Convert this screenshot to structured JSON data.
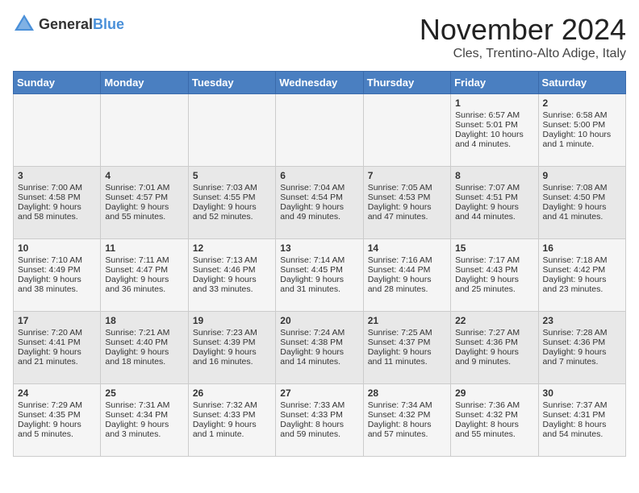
{
  "header": {
    "logo_general": "General",
    "logo_blue": "Blue",
    "month_title": "November 2024",
    "location": "Cles, Trentino-Alto Adige, Italy"
  },
  "days_of_week": [
    "Sunday",
    "Monday",
    "Tuesday",
    "Wednesday",
    "Thursday",
    "Friday",
    "Saturday"
  ],
  "weeks": [
    [
      {
        "day": "",
        "info": ""
      },
      {
        "day": "",
        "info": ""
      },
      {
        "day": "",
        "info": ""
      },
      {
        "day": "",
        "info": ""
      },
      {
        "day": "",
        "info": ""
      },
      {
        "day": "1",
        "info": "Sunrise: 6:57 AM\nSunset: 5:01 PM\nDaylight: 10 hours and 4 minutes."
      },
      {
        "day": "2",
        "info": "Sunrise: 6:58 AM\nSunset: 5:00 PM\nDaylight: 10 hours and 1 minute."
      }
    ],
    [
      {
        "day": "3",
        "info": "Sunrise: 7:00 AM\nSunset: 4:58 PM\nDaylight: 9 hours and 58 minutes."
      },
      {
        "day": "4",
        "info": "Sunrise: 7:01 AM\nSunset: 4:57 PM\nDaylight: 9 hours and 55 minutes."
      },
      {
        "day": "5",
        "info": "Sunrise: 7:03 AM\nSunset: 4:55 PM\nDaylight: 9 hours and 52 minutes."
      },
      {
        "day": "6",
        "info": "Sunrise: 7:04 AM\nSunset: 4:54 PM\nDaylight: 9 hours and 49 minutes."
      },
      {
        "day": "7",
        "info": "Sunrise: 7:05 AM\nSunset: 4:53 PM\nDaylight: 9 hours and 47 minutes."
      },
      {
        "day": "8",
        "info": "Sunrise: 7:07 AM\nSunset: 4:51 PM\nDaylight: 9 hours and 44 minutes."
      },
      {
        "day": "9",
        "info": "Sunrise: 7:08 AM\nSunset: 4:50 PM\nDaylight: 9 hours and 41 minutes."
      }
    ],
    [
      {
        "day": "10",
        "info": "Sunrise: 7:10 AM\nSunset: 4:49 PM\nDaylight: 9 hours and 38 minutes."
      },
      {
        "day": "11",
        "info": "Sunrise: 7:11 AM\nSunset: 4:47 PM\nDaylight: 9 hours and 36 minutes."
      },
      {
        "day": "12",
        "info": "Sunrise: 7:13 AM\nSunset: 4:46 PM\nDaylight: 9 hours and 33 minutes."
      },
      {
        "day": "13",
        "info": "Sunrise: 7:14 AM\nSunset: 4:45 PM\nDaylight: 9 hours and 31 minutes."
      },
      {
        "day": "14",
        "info": "Sunrise: 7:16 AM\nSunset: 4:44 PM\nDaylight: 9 hours and 28 minutes."
      },
      {
        "day": "15",
        "info": "Sunrise: 7:17 AM\nSunset: 4:43 PM\nDaylight: 9 hours and 25 minutes."
      },
      {
        "day": "16",
        "info": "Sunrise: 7:18 AM\nSunset: 4:42 PM\nDaylight: 9 hours and 23 minutes."
      }
    ],
    [
      {
        "day": "17",
        "info": "Sunrise: 7:20 AM\nSunset: 4:41 PM\nDaylight: 9 hours and 21 minutes."
      },
      {
        "day": "18",
        "info": "Sunrise: 7:21 AM\nSunset: 4:40 PM\nDaylight: 9 hours and 18 minutes."
      },
      {
        "day": "19",
        "info": "Sunrise: 7:23 AM\nSunset: 4:39 PM\nDaylight: 9 hours and 16 minutes."
      },
      {
        "day": "20",
        "info": "Sunrise: 7:24 AM\nSunset: 4:38 PM\nDaylight: 9 hours and 14 minutes."
      },
      {
        "day": "21",
        "info": "Sunrise: 7:25 AM\nSunset: 4:37 PM\nDaylight: 9 hours and 11 minutes."
      },
      {
        "day": "22",
        "info": "Sunrise: 7:27 AM\nSunset: 4:36 PM\nDaylight: 9 hours and 9 minutes."
      },
      {
        "day": "23",
        "info": "Sunrise: 7:28 AM\nSunset: 4:36 PM\nDaylight: 9 hours and 7 minutes."
      }
    ],
    [
      {
        "day": "24",
        "info": "Sunrise: 7:29 AM\nSunset: 4:35 PM\nDaylight: 9 hours and 5 minutes."
      },
      {
        "day": "25",
        "info": "Sunrise: 7:31 AM\nSunset: 4:34 PM\nDaylight: 9 hours and 3 minutes."
      },
      {
        "day": "26",
        "info": "Sunrise: 7:32 AM\nSunset: 4:33 PM\nDaylight: 9 hours and 1 minute."
      },
      {
        "day": "27",
        "info": "Sunrise: 7:33 AM\nSunset: 4:33 PM\nDaylight: 8 hours and 59 minutes."
      },
      {
        "day": "28",
        "info": "Sunrise: 7:34 AM\nSunset: 4:32 PM\nDaylight: 8 hours and 57 minutes."
      },
      {
        "day": "29",
        "info": "Sunrise: 7:36 AM\nSunset: 4:32 PM\nDaylight: 8 hours and 55 minutes."
      },
      {
        "day": "30",
        "info": "Sunrise: 7:37 AM\nSunset: 4:31 PM\nDaylight: 8 hours and 54 minutes."
      }
    ]
  ]
}
